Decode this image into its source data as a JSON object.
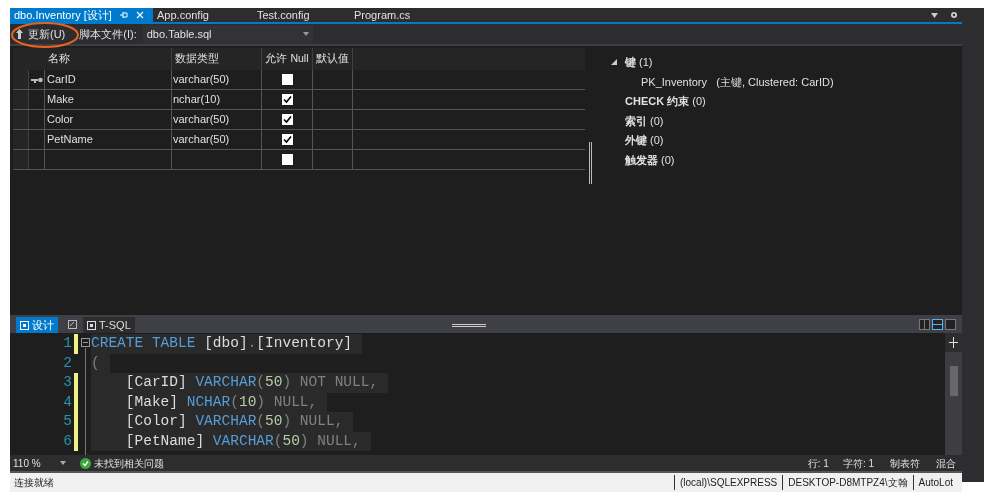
{
  "doc_tabs": [
    {
      "label": "dbo.Inventory [设计]",
      "selected": true
    },
    {
      "label": "App.config",
      "selected": false
    },
    {
      "label": "Test.config",
      "selected": false
    },
    {
      "label": "Program.cs",
      "selected": false
    }
  ],
  "toolbar": {
    "update_button": "更新(U)",
    "script_label": "脚本文件(I):",
    "script_file": "dbo.Table.sql"
  },
  "grid": {
    "columns": [
      "名称",
      "数据类型",
      "允许 Null",
      "默认值"
    ],
    "rows": [
      {
        "name": "CarID",
        "type": "varchar(50)",
        "allow_null": false,
        "primary_key": true
      },
      {
        "name": "Make",
        "type": "nchar(10)",
        "allow_null": true,
        "primary_key": false
      },
      {
        "name": "Color",
        "type": "varchar(50)",
        "allow_null": true,
        "primary_key": false
      },
      {
        "name": "PetName",
        "type": "varchar(50)",
        "allow_null": true,
        "primary_key": false
      },
      {
        "allow_null": false,
        "primary_key": false
      }
    ]
  },
  "properties": [
    {
      "label": "键",
      "count": "(1)",
      "expanded": true,
      "children": [
        {
          "label": "PK_Inventory",
          "detail": "(主键, Clustered: CarID)"
        }
      ]
    },
    {
      "label": "CHECK 约束",
      "count": "(0)",
      "expanded": false
    },
    {
      "label": "索引",
      "count": "(0)",
      "expanded": false
    },
    {
      "label": "外键",
      "count": "(0)",
      "expanded": false
    },
    {
      "label": "触发器",
      "count": "(0)",
      "expanded": false
    }
  ],
  "view_tabs": [
    {
      "label": "设计",
      "selected": true
    },
    {
      "label": "T-SQL",
      "selected": false
    }
  ],
  "code_lines": [
    {
      "number": "1",
      "changed": true,
      "tokens": [
        {
          "text": "CREATE TABLE ",
          "kind": "keyword"
        },
        {
          "text": "[dbo]",
          "kind": "ident"
        },
        {
          "text": ".",
          "kind": "null"
        },
        {
          "text": "[Inventory]",
          "kind": "ident"
        }
      ]
    },
    {
      "number": "2",
      "changed": false,
      "tokens": [
        {
          "text": "(",
          "kind": "null"
        }
      ]
    },
    {
      "number": "3",
      "changed": true,
      "tokens": [
        {
          "text": "    [CarID] ",
          "kind": "ident"
        },
        {
          "text": "VARCHAR",
          "kind": "keyword"
        },
        {
          "text": "(",
          "kind": "null"
        },
        {
          "text": "50",
          "kind": "number"
        },
        {
          "text": ") NOT NULL,",
          "kind": "null"
        }
      ]
    },
    {
      "number": "4",
      "changed": true,
      "tokens": [
        {
          "text": "    [Make] ",
          "kind": "ident"
        },
        {
          "text": "NCHAR",
          "kind": "keyword"
        },
        {
          "text": "(",
          "kind": "null"
        },
        {
          "text": "10",
          "kind": "number"
        },
        {
          "text": ") NULL,",
          "kind": "null"
        }
      ]
    },
    {
      "number": "5",
      "changed": true,
      "tokens": [
        {
          "text": "    [Color] ",
          "kind": "ident"
        },
        {
          "text": "VARCHAR",
          "kind": "keyword"
        },
        {
          "text": "(",
          "kind": "null"
        },
        {
          "text": "50",
          "kind": "number"
        },
        {
          "text": ") NULL,",
          "kind": "null"
        }
      ]
    },
    {
      "number": "6",
      "changed": true,
      "tokens": [
        {
          "text": "    [PetName] ",
          "kind": "ident"
        },
        {
          "text": "VARCHAR",
          "kind": "keyword"
        },
        {
          "text": "(",
          "kind": "null"
        },
        {
          "text": "50",
          "kind": "number"
        },
        {
          "text": ") NULL,",
          "kind": "null"
        }
      ]
    }
  ],
  "editor_bar": {
    "zoom": "110 %",
    "issues": "未找到相关问题",
    "line": "行: 1",
    "char": "字符: 1",
    "tabs": "制表符",
    "line_endings": "混合"
  },
  "status_bar": {
    "message": "连接就绪",
    "server": "(local)\\SQLEXPRESS",
    "user": "DESKTOP-D8MTPZ4\\文翰",
    "database": "AutoLot"
  }
}
